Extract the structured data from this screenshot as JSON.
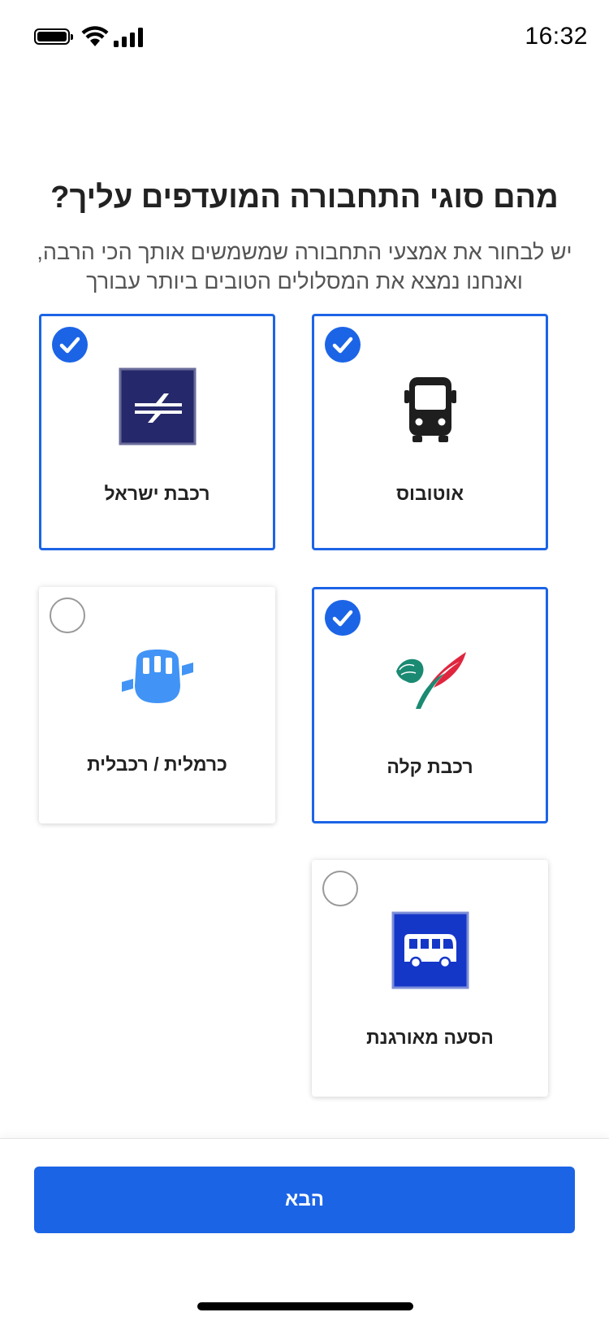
{
  "status_bar": {
    "time": "16:32",
    "battery_icon": "battery-icon",
    "wifi_icon": "wifi-icon",
    "signal_icon": "cellular-signal-icon"
  },
  "header": {
    "title": "מהם סוגי התחבורה המועדפים עליך?",
    "subtitle": "יש לבחור את אמצעי התחבורה שמשמשים אותך הכי הרבה, ואנחנו נמצא את המסלולים הטובים ביותר עבורך"
  },
  "options": [
    {
      "id": "bus",
      "label": "אוטובוס",
      "selected": true,
      "icon": "bus-icon"
    },
    {
      "id": "israel-railways",
      "label": "רכבת ישראל",
      "selected": true,
      "icon": "israel-railways-logo"
    },
    {
      "id": "light-rail",
      "label": "רכבת קלה",
      "selected": true,
      "icon": "light-rail-lion-logo"
    },
    {
      "id": "carmelit",
      "label": "כרמלית / רכבלית",
      "selected": false,
      "icon": "cable-car-icon"
    },
    {
      "id": "organized-ride",
      "label": "הסעה מאורגנת",
      "selected": false,
      "icon": "shuttle-bus-icon"
    }
  ],
  "footer": {
    "next_label": "הבא"
  },
  "colors": {
    "accent": "#1c64e6",
    "israel_railways_bg": "#25286a",
    "shuttle_bg": "#1537c8",
    "cable_car": "#4194f5",
    "light_rail_red": "#e0263f",
    "light_rail_green": "#1b8a72"
  }
}
